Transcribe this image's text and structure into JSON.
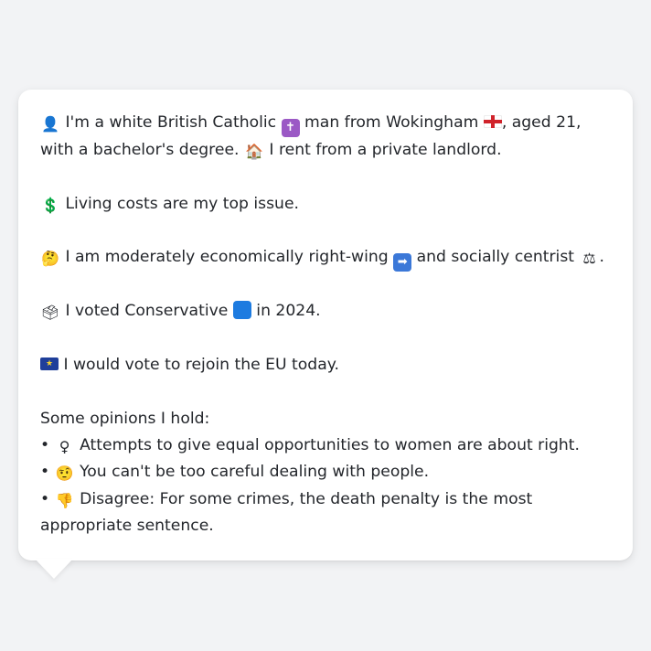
{
  "colors": {
    "page_background": "#f2f3f5",
    "bubble_background": "#ffffff",
    "text": "#23262b"
  },
  "profile": {
    "intro_a": "I'm a white British Catholic",
    "intro_b": "man from Wokingham",
    "intro_c": ", aged 21, with a bachelor's degree.",
    "housing": "I rent from a private landlord.",
    "top_issue": "Living costs are my top issue.",
    "ideology_a": "I am moderately economically right-wing",
    "ideology_b": "and socially centrist",
    "ideology_end": ".",
    "vote_a": "I voted Conservative",
    "vote_b": "in 2024.",
    "eu": "I would vote to rejoin the EU today."
  },
  "icons": {
    "person": "person-silhouette",
    "cross": "latin-cross",
    "england_flag": "england-flag",
    "house": "house",
    "dollar": "heavy-dollar-sign",
    "thinking": "thinking-face",
    "right_arrow": "right-arrow",
    "scales": "balance-scale",
    "ballot": "ballot-box",
    "blue_square": "blue-square",
    "eu_flag": "eu-flag",
    "female": "female-sign",
    "raised_eyebrow": "face-with-raised-eyebrow",
    "thumbs_down": "thumbs-down"
  },
  "opinions": {
    "heading": "Some opinions I hold:",
    "bullet": "•",
    "items": [
      {
        "text": "Attempts to give equal opportunities to women are about right."
      },
      {
        "text": "You can't be too careful dealing with people."
      },
      {
        "text": "Disagree: For some crimes, the death penalty is the most appropriate sentence."
      }
    ]
  }
}
